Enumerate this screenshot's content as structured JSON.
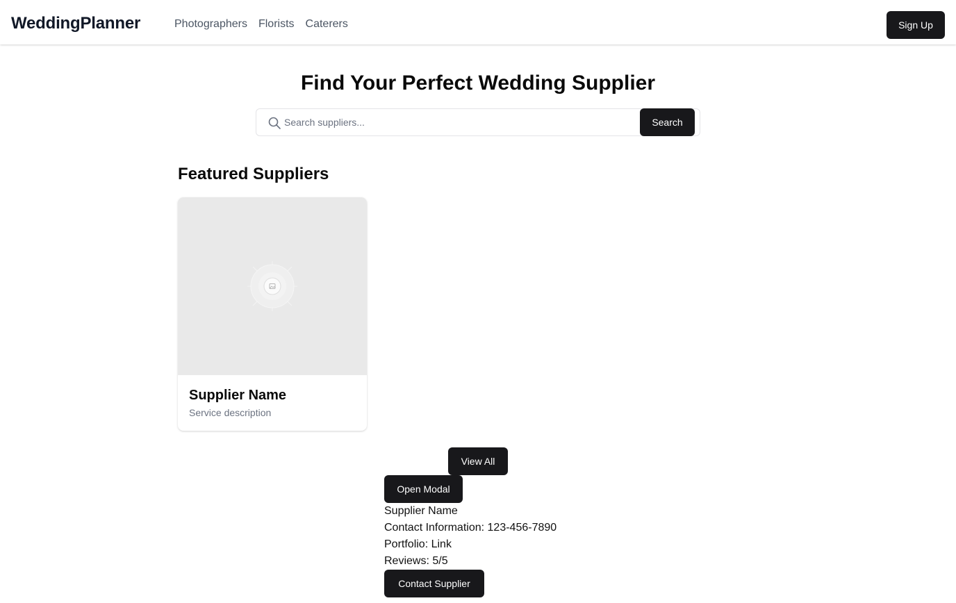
{
  "header": {
    "brand": "WeddingPlanner",
    "nav": [
      "Photographers",
      "Florists",
      "Caterers"
    ],
    "signup_label": "Sign Up"
  },
  "hero": {
    "title": "Find Your Perfect Wedding Supplier",
    "search_placeholder": "Search suppliers...",
    "search_value": "",
    "search_button": "Search"
  },
  "featured": {
    "title": "Featured Suppliers",
    "cards": [
      {
        "name": "Supplier Name",
        "description": "Service description",
        "image_icon": "image-placeholder-icon"
      }
    ],
    "view_all_label": "View All"
  },
  "modal": {
    "open_label": "Open Modal",
    "supplier_name": "Supplier Name",
    "contact": "Contact Information: 123-456-7890",
    "portfolio": "Portfolio: Link",
    "reviews": "Reviews: 5/5",
    "contact_button": "Contact Supplier"
  },
  "colors": {
    "primary_button": "#18181b",
    "muted_text": "#6b7280",
    "placeholder_bg": "#e9e9e9"
  }
}
